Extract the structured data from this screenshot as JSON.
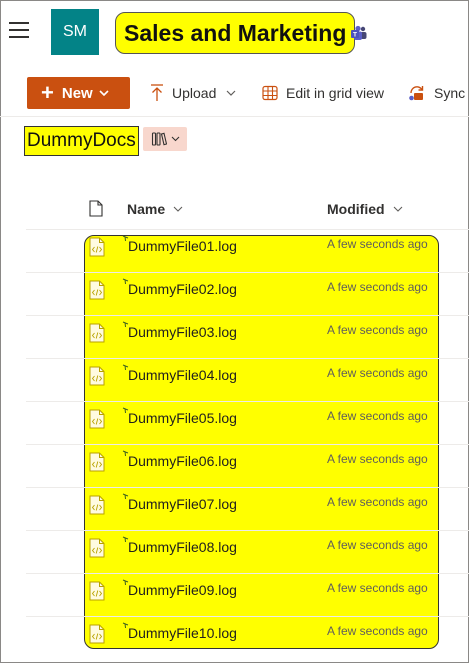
{
  "header": {
    "logo_text": "SM",
    "site_title": "Sales and Marketing"
  },
  "toolbar": {
    "new_label": "New",
    "upload_label": "Upload",
    "grid_label": "Edit in grid view",
    "sync_label": "Sync"
  },
  "library": {
    "title": "DummyDocs"
  },
  "columns": {
    "name": "Name",
    "modified": "Modified"
  },
  "files": [
    {
      "name": "DummyFile01.log",
      "modified": "A few seconds ago"
    },
    {
      "name": "DummyFile02.log",
      "modified": "A few seconds ago"
    },
    {
      "name": "DummyFile03.log",
      "modified": "A few seconds ago"
    },
    {
      "name": "DummyFile04.log",
      "modified": "A few seconds ago"
    },
    {
      "name": "DummyFile05.log",
      "modified": "A few seconds ago"
    },
    {
      "name": "DummyFile06.log",
      "modified": "A few seconds ago"
    },
    {
      "name": "DummyFile07.log",
      "modified": "A few seconds ago"
    },
    {
      "name": "DummyFile08.log",
      "modified": "A few seconds ago"
    },
    {
      "name": "DummyFile09.log",
      "modified": "A few seconds ago"
    },
    {
      "name": "DummyFile10.log",
      "modified": "A few seconds ago"
    }
  ],
  "colors": {
    "accent": "#ca5010",
    "logo_bg": "#038387",
    "highlight": "#ffff00"
  },
  "icons": {
    "menu": "hamburger-icon",
    "teams": "teams-icon",
    "upload": "upload-arrow-icon",
    "grid": "grid-icon",
    "sync": "sync-icon",
    "view": "library-view-icon",
    "file": "code-file-icon",
    "new_item": "new-item-sparkle-icon"
  }
}
